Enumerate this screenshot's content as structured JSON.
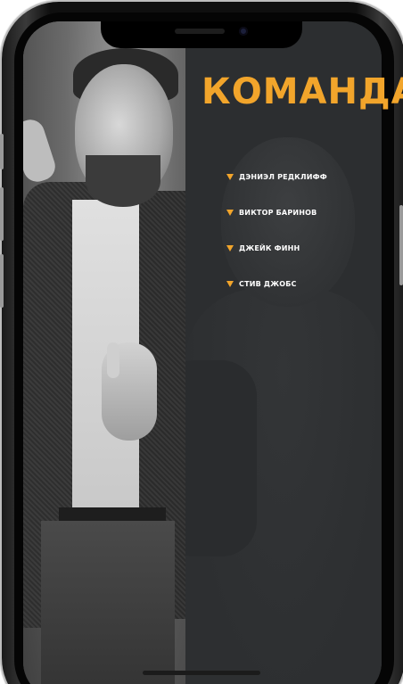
{
  "screen": {
    "title": "КОМАНДА",
    "accent_color": "#f2a52b",
    "background_color": "#2b2d2f",
    "text_color": "#ffffff"
  },
  "team": {
    "bullet_icon": "triangle-down-icon",
    "members": [
      {
        "name": "ДЭНИЭЛ РЕДКЛИФФ"
      },
      {
        "name": "ВИКТОР БАРИНОВ"
      },
      {
        "name": "ДЖЕЙК ФИНН"
      },
      {
        "name": "СТИВ ДЖОБС"
      }
    ]
  }
}
